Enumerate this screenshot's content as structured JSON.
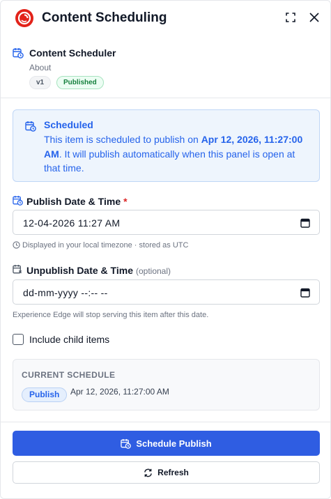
{
  "header": {
    "title": "Content Scheduling",
    "logo_icon": "sitecore-logo",
    "brand_color": "#e2231a"
  },
  "app": {
    "name": "Content Scheduler",
    "about_label": "About",
    "version": "v1",
    "status": "Published"
  },
  "alert": {
    "title": "Scheduled",
    "body_prefix": "This item is scheduled to publish on ",
    "body_date": "Apr 12, 2026, 11:27:00 AM",
    "body_suffix": ". It will publish automatically when this panel is open at that time."
  },
  "publish": {
    "label": "Publish Date & Time",
    "required_mark": "*",
    "value": "12-04-2026 11:27  AM",
    "help": "Displayed in your local timezone · stored as UTC"
  },
  "unpublish": {
    "label": "Unpublish Date & Time",
    "optional_label": "(optional)",
    "value": "dd-mm-yyyy --:-- --",
    "help": "Experience Edge will stop serving this item after this date."
  },
  "options": {
    "include_children_label": "Include child items",
    "include_children_checked": false
  },
  "current_schedule": {
    "heading": "CURRENT SCHEDULE",
    "action": "Publish",
    "date": "Apr 12, 2026, 11:27:00 AM"
  },
  "buttons": {
    "schedule_label": "Schedule Publish",
    "refresh_label": "Refresh"
  },
  "colors": {
    "accent": "#2f5de2",
    "alert_bg": "#eef5fd",
    "alert_text": "#2563eb",
    "success": "#15803d",
    "required": "#dc2626"
  }
}
